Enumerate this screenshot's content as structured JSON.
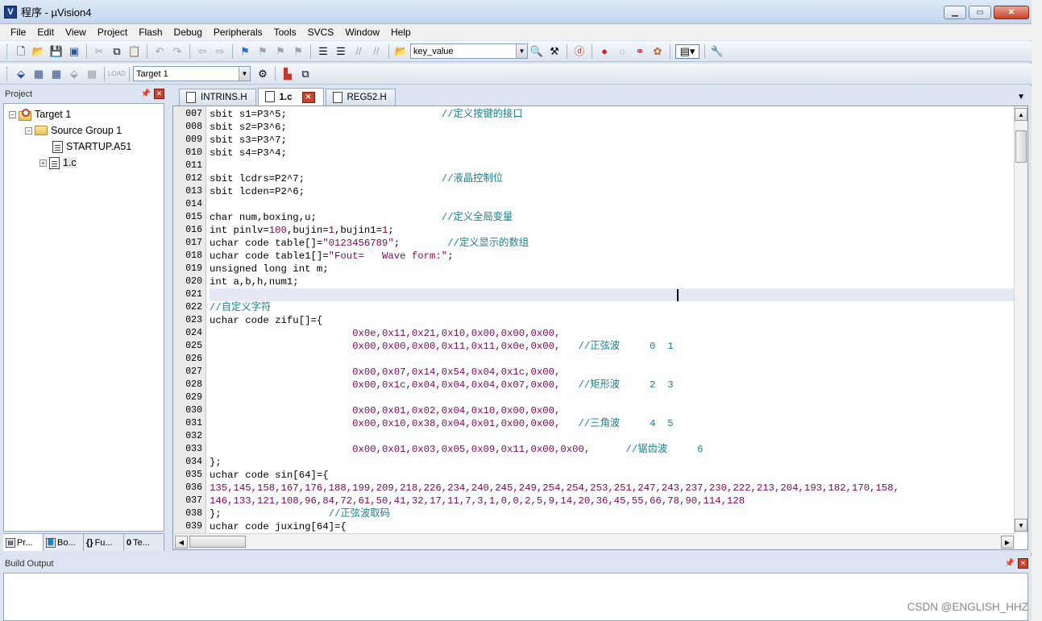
{
  "window": {
    "title": "程序 - µVision4",
    "icon": "V"
  },
  "menu": [
    "File",
    "Edit",
    "View",
    "Project",
    "Flash",
    "Debug",
    "Peripherals",
    "Tools",
    "SVCS",
    "Window",
    "Help"
  ],
  "toolbar": {
    "find_combo": "key_value",
    "target_combo": "Target 1"
  },
  "project_panel": {
    "title": "Project",
    "tree": {
      "target": "Target 1",
      "group": "Source Group 1",
      "files": [
        "STARTUP.A51",
        "1.c"
      ]
    },
    "tabs": [
      "Pr...",
      "Bo...",
      "Fu...",
      "Te..."
    ]
  },
  "editor": {
    "tabs": [
      {
        "label": "INTRINS.H"
      },
      {
        "label": "1.c"
      },
      {
        "label": "REG52.H"
      }
    ],
    "lines": [
      {
        "n": "007",
        "tokens": [
          {
            "t": "sbit s1=P3^5;",
            "c": "kw"
          },
          {
            "t": "                          //定义按键的接口",
            "c": "cmt"
          }
        ]
      },
      {
        "n": "008",
        "tokens": [
          {
            "t": "sbit s2=P3^6;",
            "c": "kw"
          }
        ]
      },
      {
        "n": "009",
        "tokens": [
          {
            "t": "sbit s3=P3^7;",
            "c": "kw"
          }
        ]
      },
      {
        "n": "010",
        "tokens": [
          {
            "t": "sbit s4=P3^4;",
            "c": "kw"
          }
        ]
      },
      {
        "n": "011",
        "tokens": []
      },
      {
        "n": "012",
        "tokens": [
          {
            "t": "sbit lcdrs=P2^7;",
            "c": "kw"
          },
          {
            "t": "                       //液晶控制位",
            "c": "cmt"
          }
        ]
      },
      {
        "n": "013",
        "tokens": [
          {
            "t": "sbit lcden=P2^6;",
            "c": "kw"
          }
        ]
      },
      {
        "n": "014",
        "tokens": []
      },
      {
        "n": "015",
        "tokens": [
          {
            "t": "char num,boxing,u;",
            "c": "kw"
          },
          {
            "t": "                     //定义全局变量",
            "c": "cmt"
          }
        ]
      },
      {
        "n": "016",
        "tokens": [
          {
            "t": "int pinlv=",
            "c": "kw"
          },
          {
            "t": "100",
            "c": "num"
          },
          {
            "t": ",bujin=",
            "c": "kw"
          },
          {
            "t": "1",
            "c": "num"
          },
          {
            "t": ",bujin1=",
            "c": "kw"
          },
          {
            "t": "1",
            "c": "num"
          },
          {
            "t": ";",
            "c": "kw"
          }
        ]
      },
      {
        "n": "017",
        "tokens": [
          {
            "t": "uchar code table[]=",
            "c": "kw"
          },
          {
            "t": "\"0123456789\"",
            "c": "str"
          },
          {
            "t": ";        ",
            "c": "kw"
          },
          {
            "t": "//定义显示的数组",
            "c": "cmt"
          }
        ]
      },
      {
        "n": "018",
        "tokens": [
          {
            "t": "uchar code table1[]=",
            "c": "kw"
          },
          {
            "t": "\"Fout=   Wave form:\"",
            "c": "str"
          },
          {
            "t": ";",
            "c": "kw"
          }
        ]
      },
      {
        "n": "019",
        "tokens": [
          {
            "t": "unsigned long int m;",
            "c": "kw"
          }
        ]
      },
      {
        "n": "020",
        "tokens": [
          {
            "t": "int a,b,h,num1;",
            "c": "kw"
          }
        ]
      },
      {
        "n": "021",
        "tokens": []
      },
      {
        "n": "022",
        "tokens": [
          {
            "t": "//自定义字符",
            "c": "cmt"
          }
        ]
      },
      {
        "n": "023",
        "tokens": [
          {
            "t": "uchar code zifu[]={",
            "c": "kw"
          }
        ]
      },
      {
        "n": "024",
        "tokens": [
          {
            "t": "                        0x0e,0x11,0x21,0x10,0x00,0x00,0x00,",
            "c": "num"
          }
        ]
      },
      {
        "n": "025",
        "tokens": [
          {
            "t": "                        0x00,0x00,0x00,0x11,0x11,0x0e,0x00,",
            "c": "num"
          },
          {
            "t": "   //正弦波     0  1",
            "c": "cmt"
          }
        ]
      },
      {
        "n": "026",
        "tokens": []
      },
      {
        "n": "027",
        "tokens": [
          {
            "t": "                        0x00,0x07,0x14,0x54,0x04,0x1c,0x00,",
            "c": "num"
          }
        ]
      },
      {
        "n": "028",
        "tokens": [
          {
            "t": "                        0x00,0x1c,0x04,0x04,0x04,0x07,0x00,",
            "c": "num"
          },
          {
            "t": "   //矩形波     2  3",
            "c": "cmt"
          }
        ]
      },
      {
        "n": "029",
        "tokens": []
      },
      {
        "n": "030",
        "tokens": [
          {
            "t": "                        0x00,0x01,0x02,0x04,0x10,0x00,0x00,",
            "c": "num"
          }
        ]
      },
      {
        "n": "031",
        "tokens": [
          {
            "t": "                        0x00,0x10,0x38,0x04,0x01,0x00,0x00,",
            "c": "num"
          },
          {
            "t": "   //三角波     4  5",
            "c": "cmt"
          }
        ]
      },
      {
        "n": "032",
        "tokens": []
      },
      {
        "n": "033",
        "tokens": [
          {
            "t": "                        0x00,0x01,0x03,0x05,0x09,0x11,0x00,0x00,",
            "c": "num"
          },
          {
            "t": "      //锯齿波     6",
            "c": "cmt"
          }
        ]
      },
      {
        "n": "034",
        "tokens": [
          {
            "t": "};",
            "c": "kw"
          }
        ]
      },
      {
        "n": "035",
        "tokens": [
          {
            "t": "uchar code sin[64]={",
            "c": "kw"
          }
        ]
      },
      {
        "n": "036",
        "tokens": [
          {
            "t": "135,145,158,167,176,188,199,209,218,226,234,240,245,249,254,254,253,251,247,243,237,230,222,213,204,193,182,170,158,",
            "c": "num"
          }
        ]
      },
      {
        "n": "037",
        "tokens": [
          {
            "t": "146,133,121,108,96,84,72,61,50,41,32,17,11,7,3,1,0,0,2,5,9,14,20,36,45,55,66,78,90,114,128",
            "c": "num"
          }
        ]
      },
      {
        "n": "038",
        "tokens": [
          {
            "t": "};",
            "c": "kw"
          },
          {
            "t": "                  //正弦波取码",
            "c": "cmt"
          }
        ]
      },
      {
        "n": "039",
        "tokens": [
          {
            "t": "uchar code juxing[64]={",
            "c": "kw"
          }
        ]
      }
    ]
  },
  "build_output": {
    "title": "Build Output"
  },
  "watermark": "CSDN @ENGLISH_HHZ"
}
